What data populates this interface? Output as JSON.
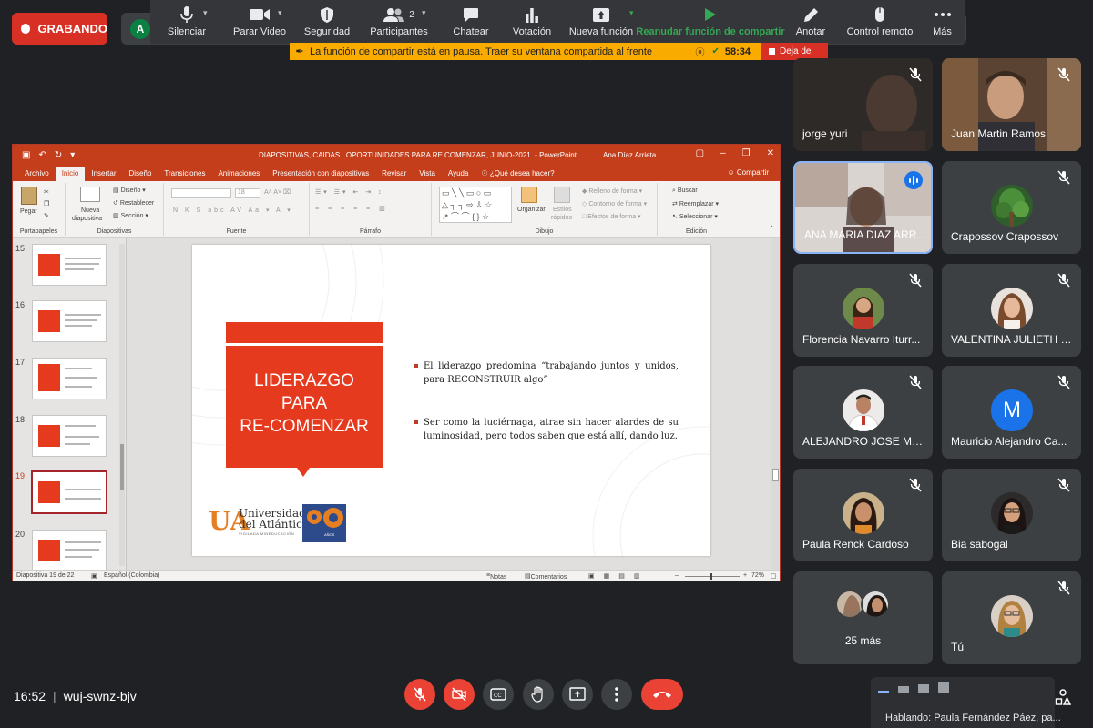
{
  "recording": {
    "label": "GRABANDO"
  },
  "host_avatar": {
    "letter": "A"
  },
  "toolbar": [
    {
      "label": "Silenciar",
      "icon": "mic-icon"
    },
    {
      "label": "Parar Video",
      "icon": "video-icon"
    },
    {
      "label": "Seguridad",
      "icon": "shield-icon"
    },
    {
      "label": "Participantes",
      "icon": "participants-icon",
      "count": "2"
    },
    {
      "label": "Chatear",
      "icon": "chat-icon"
    },
    {
      "label": "Votación",
      "icon": "poll-icon"
    },
    {
      "label": "Nueva función",
      "icon": "share-screen-icon"
    },
    {
      "label": "Reanudar función de compartir",
      "icon": "play-icon"
    },
    {
      "label": "Anotar",
      "icon": "pencil-icon"
    },
    {
      "label": "Control remoto",
      "icon": "mouse-icon"
    },
    {
      "label": "Más",
      "icon": "more-icon"
    }
  ],
  "banner": {
    "message": "La función de compartir está en pausa. Traer su ventana compartida al frente",
    "timer": "58:34",
    "stop_label": "Deja de"
  },
  "ppt": {
    "doc_title": "DIAPOSITIVAS, CAIDAS...OPORTUNIDADES PARA RE COMENZAR, JUNIO-2021.  -  PowerPoint",
    "user": "Ana Díaz Arrieta",
    "tabs": [
      "Archivo",
      "Inicio",
      "Insertar",
      "Diseño",
      "Transiciones",
      "Animaciones",
      "Presentación con diapositivas",
      "Revisar",
      "Vista",
      "Ayuda",
      "¿Qué desea hacer?"
    ],
    "share_label": "Compartir",
    "ribbon": {
      "pegar": "Pegar",
      "portapapeles": "Portapapeles",
      "nueva1": "Nueva",
      "nueva2": "diapositiva",
      "diseno": "Diseño",
      "restablecer": "Restablecer",
      "seccion": "Sección",
      "diapositivas": "Diapositivas",
      "font_size": "18",
      "fuente": "Fuente",
      "parrafo": "Párrafo",
      "organizar": "Organizar",
      "estilos1": "Estilos",
      "estilos2": "rápidos",
      "relleno": "Relleno de forma",
      "contorno": "Contorno de forma",
      "efectos": "Efectos de forma",
      "dibujo": "Dibujo",
      "buscar": "Buscar",
      "reemplazar": "Reemplazar",
      "seleccionar": "Seleccionar",
      "edicion": "Edición"
    },
    "thumbs": [
      {
        "num": "15"
      },
      {
        "num": "16"
      },
      {
        "num": "17"
      },
      {
        "num": "18"
      },
      {
        "num": "19"
      },
      {
        "num": "20"
      }
    ],
    "slide": {
      "title_line1": "LIDERAZGO",
      "title_line2": "PARA",
      "title_line3": "RE-COMENZAR",
      "bullet1": "El liderazgo predomina “trabajando juntos y unidos, para RECONSTRUIR algo”",
      "bullet2": "Ser como la luciérnaga, atrae sin hacer alardes de su luminosidad, pero todos saben que está allí, dando luz.",
      "logo_ua": "UA",
      "logo_line1": "Universidad",
      "logo_line2": "del Atlántico",
      "logo_sub": "VIGILADA MINEDUCACIÓN",
      "logo_anos": "AÑOS"
    },
    "status": {
      "slide_count": "Diapositiva 19 de 22",
      "language": "Español (Colombia)",
      "notas": "Notas",
      "comentarios": "Comentarios",
      "zoom": "72%"
    }
  },
  "participants": [
    {
      "name": "jorge yuri",
      "type": "video",
      "muted": true
    },
    {
      "name": "Juan Martin Ramos",
      "type": "video",
      "muted": true
    },
    {
      "name": "ANA MARIA DIAZ ARR...",
      "type": "video",
      "speaking": true
    },
    {
      "name": "Crapossov Crapossov",
      "type": "photo",
      "muted": true
    },
    {
      "name": "Florencia Navarro Iturr...",
      "type": "photo",
      "muted": true
    },
    {
      "name": "VALENTINA JULIETH O...",
      "type": "photo",
      "muted": true
    },
    {
      "name": "ALEJANDRO JOSE MA...",
      "type": "photo",
      "muted": true
    },
    {
      "name": "Mauricio Alejandro Ca...",
      "type": "letter",
      "letter": "M",
      "muted": true
    },
    {
      "name": "Paula Renck Cardoso",
      "type": "photo",
      "muted": true
    },
    {
      "name": "Bia sabogal",
      "type": "photo",
      "muted": true
    },
    {
      "name": "25 más",
      "type": "more"
    },
    {
      "name": "Tú",
      "type": "photo",
      "muted": true
    }
  ],
  "bottom": {
    "time": "16:52",
    "meeting_code": "wuj-swnz-bjv",
    "speaking_hint": "Hablando: Paula Fernández Páez, pa..."
  },
  "colors": {
    "background": "#202124",
    "tile": "#3c4043",
    "recording": "#d93025",
    "banner": "#f9ab00",
    "ppt_accent": "#c43e1c",
    "slide_red": "#e63a1f",
    "speaking_border": "#8ab4f8"
  }
}
